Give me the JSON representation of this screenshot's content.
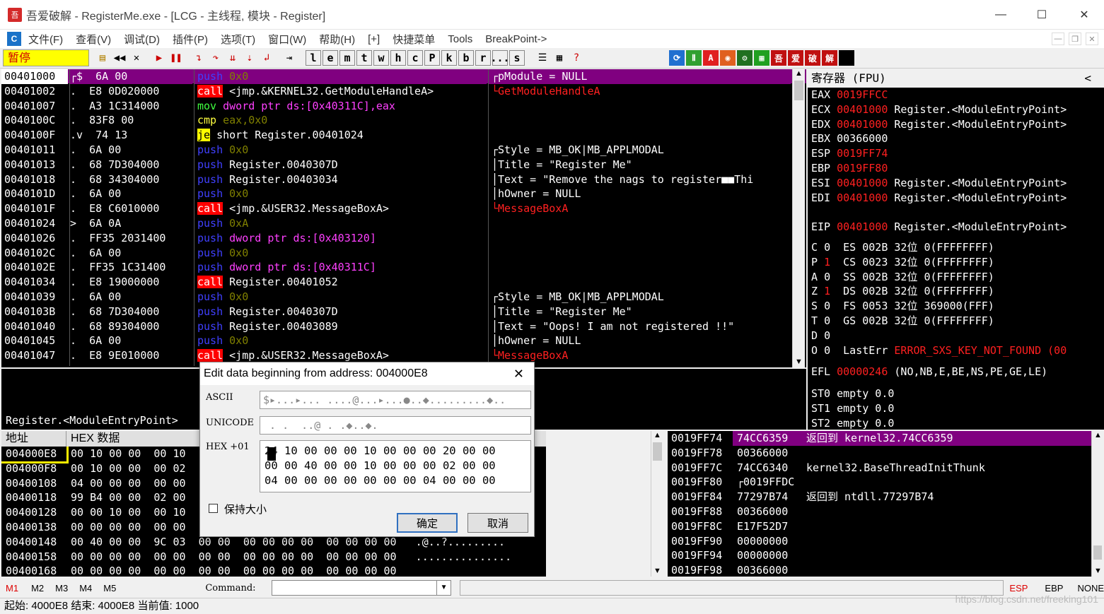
{
  "window": {
    "title": "吾爱破解 - RegisterMe.exe - [LCG - 主线程, 模块 - Register]",
    "min": "—",
    "max": "☐",
    "close": "✕"
  },
  "menu": [
    "文件(F)",
    "查看(V)",
    "调试(D)",
    "插件(P)",
    "选项(T)",
    "窗口(W)",
    "帮助(H)",
    "[+]",
    "快捷菜单",
    "Tools",
    "BreakPoint->"
  ],
  "toolbar": {
    "status": "暂停",
    "letters": [
      "l",
      "e",
      "m",
      "t",
      "w",
      "h",
      "c",
      "P",
      "k",
      "b",
      "r",
      "...",
      "s"
    ]
  },
  "disasm": {
    "header": {
      "addr": "00401000",
      "marker": "┌$",
      "hex": "6A 00",
      "op": "push",
      "args": "0x0",
      "comment": "┌pModule = NULL"
    },
    "rows": [
      {
        "addr": "00401002",
        "m": ".",
        "hex": "E8 0D020000",
        "op": "call",
        "cls": "asm-call",
        "args": " <jmp.&KERNEL32.GetModuleHandleA>",
        "comment": "└GetModuleHandleA",
        "ccls": "cm-red"
      },
      {
        "addr": "00401007",
        "m": ".",
        "hex": "A3 1C314000",
        "op": "mov",
        "cls": "asm-mov",
        "args": " dword ptr ds:[0x40311C],eax",
        "comment": "",
        "ccls": ""
      },
      {
        "addr": "0040100C",
        "m": ".",
        "hex": "83F8 00",
        "op": "cmp",
        "cls": "asm-cmp",
        "args": " eax,0x0",
        "comment": "",
        "ccls": ""
      },
      {
        "addr": "0040100F",
        "m": ".v",
        "hex": "74 13",
        "op": "je",
        "cls": "asm-je",
        "args": " short Register.00401024",
        "comment": "",
        "ccls": ""
      },
      {
        "addr": "00401011",
        "m": ".",
        "hex": "6A 00",
        "op": "push",
        "cls": "asm-push",
        "args": " 0x0",
        "comment": "┌Style = MB_OK|MB_APPLMODAL",
        "ccls": ""
      },
      {
        "addr": "00401013",
        "m": ".",
        "hex": "68 7D304000",
        "op": "push",
        "cls": "asm-push",
        "args": " Register.0040307D",
        "comment": "│Title = \"Register Me\"",
        "ccls": ""
      },
      {
        "addr": "00401018",
        "m": ".",
        "hex": "68 34304000",
        "op": "push",
        "cls": "asm-push",
        "args": " Register.00403034",
        "comment": "│Text = \"Remove the nags to register■■Thi",
        "ccls": ""
      },
      {
        "addr": "0040101D",
        "m": ".",
        "hex": "6A 00",
        "op": "push",
        "cls": "asm-push",
        "args": " 0x0",
        "comment": "│hOwner = NULL",
        "ccls": ""
      },
      {
        "addr": "0040101F",
        "m": ".",
        "hex": "E8 C6010000",
        "op": "call",
        "cls": "asm-call",
        "args": " <jmp.&USER32.MessageBoxA>",
        "comment": "└MessageBoxA",
        "ccls": "cm-red"
      },
      {
        "addr": "00401024",
        "m": ">",
        "hex": "6A 0A",
        "op": "push",
        "cls": "asm-push",
        "args": " 0xA",
        "comment": "",
        "ccls": ""
      },
      {
        "addr": "00401026",
        "m": ".",
        "hex": "FF35 2031400",
        "op": "push",
        "cls": "asm-push",
        "args": " dword ptr ds:[0x403120]",
        "comment": "",
        "ccls": ""
      },
      {
        "addr": "0040102C",
        "m": ".",
        "hex": "6A 00",
        "op": "push",
        "cls": "asm-push",
        "args": " 0x0",
        "comment": "",
        "ccls": ""
      },
      {
        "addr": "0040102E",
        "m": ".",
        "hex": "FF35 1C31400",
        "op": "push",
        "cls": "asm-push",
        "args": " dword ptr ds:[0x40311C]",
        "comment": "",
        "ccls": ""
      },
      {
        "addr": "00401034",
        "m": ".",
        "hex": "E8 19000000",
        "op": "call",
        "cls": "asm-call",
        "args": " Register.00401052",
        "comment": "",
        "ccls": ""
      },
      {
        "addr": "00401039",
        "m": ".",
        "hex": "6A 00",
        "op": "push",
        "cls": "asm-push",
        "args": " 0x0",
        "comment": "┌Style = MB_OK|MB_APPLMODAL",
        "ccls": ""
      },
      {
        "addr": "0040103B",
        "m": ".",
        "hex": "68 7D304000",
        "op": "push",
        "cls": "asm-push",
        "args": " Register.0040307D",
        "comment": "│Title = \"Register Me\"",
        "ccls": ""
      },
      {
        "addr": "00401040",
        "m": ".",
        "hex": "68 89304000",
        "op": "push",
        "cls": "asm-push",
        "args": " Register.00403089",
        "comment": "│Text = \"Oops! I am not registered !!\"",
        "ccls": ""
      },
      {
        "addr": "00401045",
        "m": ".",
        "hex": "6A 00",
        "op": "push",
        "cls": "asm-push",
        "args": " 0x0",
        "comment": "│hOwner = NULL",
        "ccls": ""
      },
      {
        "addr": "00401047",
        "m": ".",
        "hex": "E8 9E010000",
        "op": "call",
        "cls": "asm-call",
        "args": " <jmp.&USER32.MessageBoxA>",
        "comment": "└MessageBoxA",
        "ccls": "cm-red"
      }
    ]
  },
  "info": {
    "line": "Register.<ModuleEntryPoint>"
  },
  "registers": {
    "header": "寄存器 (FPU)",
    "collapse": "<",
    "rows": [
      {
        "name": "EAX",
        "val": "0019FFCC",
        "red": true,
        "desc": ""
      },
      {
        "name": "ECX",
        "val": "00401000",
        "red": true,
        "desc": "Register.<ModuleEntryPoint>"
      },
      {
        "name": "EDX",
        "val": "00401000",
        "red": true,
        "desc": "Register.<ModuleEntryPoint>"
      },
      {
        "name": "EBX",
        "val": "00366000",
        "red": false,
        "desc": ""
      },
      {
        "name": "ESP",
        "val": "0019FF74",
        "red": true,
        "desc": ""
      },
      {
        "name": "EBP",
        "val": "0019FF80",
        "red": true,
        "desc": ""
      },
      {
        "name": "ESI",
        "val": "00401000",
        "red": true,
        "desc": "Register.<ModuleEntryPoint>"
      },
      {
        "name": "EDI",
        "val": "00401000",
        "red": true,
        "desc": "Register.<ModuleEntryPoint>"
      },
      {
        "name": "",
        "val": "",
        "red": false,
        "desc": ""
      },
      {
        "name": "EIP",
        "val": "00401000",
        "red": true,
        "desc": "Register.<ModuleEntryPoint>"
      }
    ],
    "flags": [
      {
        "f": "C",
        "v": "0",
        "red": false,
        "seg": "ES 002B 32位 0(FFFFFFFF)"
      },
      {
        "f": "P",
        "v": "1",
        "red": true,
        "seg": "CS 0023 32位 0(FFFFFFFF)"
      },
      {
        "f": "A",
        "v": "0",
        "red": false,
        "seg": "SS 002B 32位 0(FFFFFFFF)"
      },
      {
        "f": "Z",
        "v": "1",
        "red": true,
        "seg": "DS 002B 32位 0(FFFFFFFF)"
      },
      {
        "f": "S",
        "v": "0",
        "red": false,
        "seg": "FS 0053 32位 369000(FFF)"
      },
      {
        "f": "T",
        "v": "0",
        "red": false,
        "seg": "GS 002B 32位 0(FFFFFFFF)"
      },
      {
        "f": "D",
        "v": "0",
        "red": false,
        "seg": ""
      },
      {
        "f": "O",
        "v": "0",
        "red": false,
        "seg": "LastErr "
      }
    ],
    "lasterr": "ERROR_SXS_KEY_NOT_FOUND (00",
    "efl": {
      "label": "EFL",
      "val": "00000246",
      "desc": "(NO,NB,E,BE,NS,PE,GE,LE)"
    },
    "fpu": [
      "ST0 empty 0.0",
      "ST1 empty 0.0",
      "ST2 empty 0.0"
    ]
  },
  "dump": {
    "h_addr": "地址",
    "h_hex": "HEX 数据",
    "rows": [
      {
        "addr": "004000E8",
        "hex": "00 10 00 00  00 10"
      },
      {
        "addr": "004000F8",
        "hex": "00 10 00 00  00 02"
      },
      {
        "addr": "00400108",
        "hex": "04 00 00 00  00 00"
      },
      {
        "addr": "00400118",
        "hex": "99 B4 00 00  02 00"
      },
      {
        "addr": "00400128",
        "hex": "00 00 10 00  00 10"
      },
      {
        "addr": "00400138",
        "hex": "00 00 00 00  00 00"
      },
      {
        "addr": "00400148",
        "hex": "00 40 00 00  9C 03  00 00  00 00 00 00  00 00 00 00   .@..?........."
      },
      {
        "addr": "00400158",
        "hex": "00 00 00 00  00 00  00 00  00 00 00 00  00 00 00 00   ..............."
      },
      {
        "addr": "00400168",
        "hex": "00 00 00 00  00 00  00 00  00 00 00 00  00 00 00 00"
      }
    ]
  },
  "stack": {
    "rows": [
      {
        "addr": "0019FF74",
        "val": "74CC6359",
        "desc": "返回到 kernel32.74CC6359",
        "hl": true
      },
      {
        "addr": "0019FF78",
        "val": "00366000",
        "desc": "",
        "hl": false
      },
      {
        "addr": "0019FF7C",
        "val": "74CC6340",
        "desc": "kernel32.BaseThreadInitThunk",
        "hl": false
      },
      {
        "addr": "0019FF80",
        "val": "┌0019FFDC",
        "desc": "",
        "hl": false
      },
      {
        "addr": "0019FF84",
        "val": "77297B74",
        "desc": "返回到 ntdll.77297B74",
        "hl": false
      },
      {
        "addr": "0019FF88",
        "val": "00366000",
        "desc": "",
        "hl": false
      },
      {
        "addr": "0019FF8C",
        "val": "E17F52D7",
        "desc": "",
        "hl": false
      },
      {
        "addr": "0019FF90",
        "val": "00000000",
        "desc": "",
        "hl": false
      },
      {
        "addr": "0019FF94",
        "val": "00000000",
        "desc": "",
        "hl": false
      },
      {
        "addr": "0019FF98",
        "val": "00366000",
        "desc": "",
        "hl": false
      }
    ]
  },
  "cmdbar": {
    "m": [
      "M1",
      "M2",
      "M3",
      "M4",
      "M5"
    ],
    "command_label": "Command:",
    "command_value": "",
    "right": [
      "ESP",
      "EBP",
      "NONE"
    ]
  },
  "statusbar": "起始: 4000E8 结束: 4000E8 当前值: 1000",
  "watermark": "https://blog.csdn.net/freeking101",
  "dialog": {
    "title": "Edit data beginning from address: 004000E8",
    "ascii_label": "ASCII",
    "ascii_value": "$▸...▸... ....@...▸...●..◆.........◆..",
    "unicode_label": "UNICODE",
    "unicode_value": " . .  ..@ . .◆..◆.",
    "hex_label": "HEX +01",
    "hex_lines": [
      "24 10 00 00 00 10 00 00 00 20 00 00",
      "00 00 40 00 00 10 00 00 00 02 00 00",
      "04 00 00 00 00 00 00 00 04 00 00 00"
    ],
    "keep_size": "保持大小",
    "ok": "确定",
    "cancel": "取消"
  }
}
